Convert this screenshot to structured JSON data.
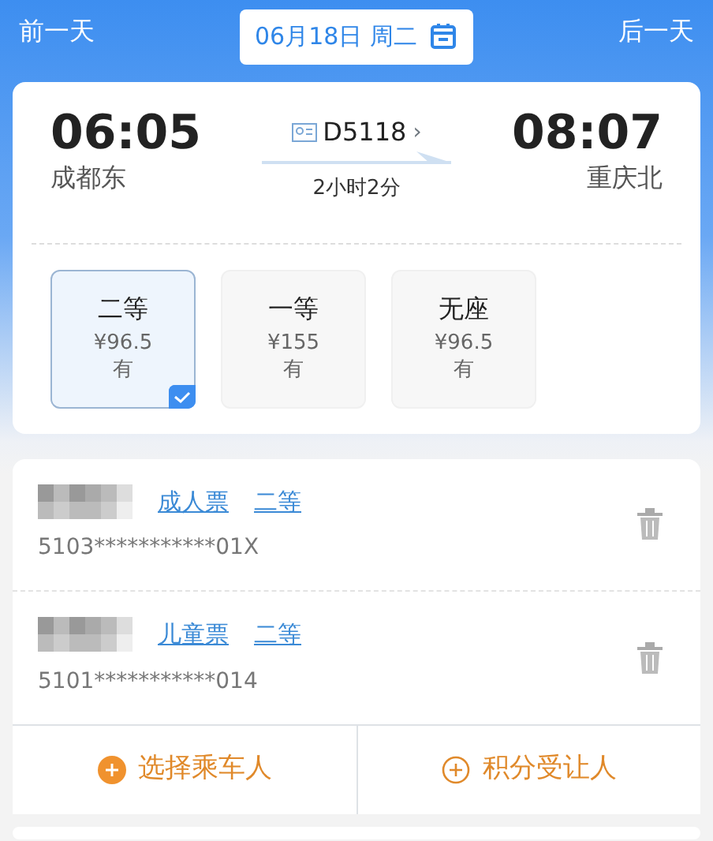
{
  "date_bar": {
    "prev": "前一天",
    "date": "06月18日 周二",
    "next": "后一天"
  },
  "train": {
    "depart_time": "06:05",
    "depart_station": "成都东",
    "number": "D5118",
    "chevron": "›",
    "duration": "2小时2分",
    "arrive_time": "08:07",
    "arrive_station": "重庆北"
  },
  "seats": [
    {
      "name": "二等",
      "price": "¥96.5",
      "availability": "有",
      "selected": true
    },
    {
      "name": "一等",
      "price": "¥155",
      "availability": "有",
      "selected": false
    },
    {
      "name": "无座",
      "price": "¥96.5",
      "availability": "有",
      "selected": false
    }
  ],
  "passengers": [
    {
      "ticket_type": "成人票",
      "seat": "二等",
      "id_number": "5103***********01X"
    },
    {
      "ticket_type": "儿童票",
      "seat": "二等",
      "id_number": "5101***********014"
    }
  ],
  "actions": [
    {
      "label": "选择乘车人",
      "kind": "filled"
    },
    {
      "label": "积分受让人",
      "kind": "outline"
    }
  ]
}
